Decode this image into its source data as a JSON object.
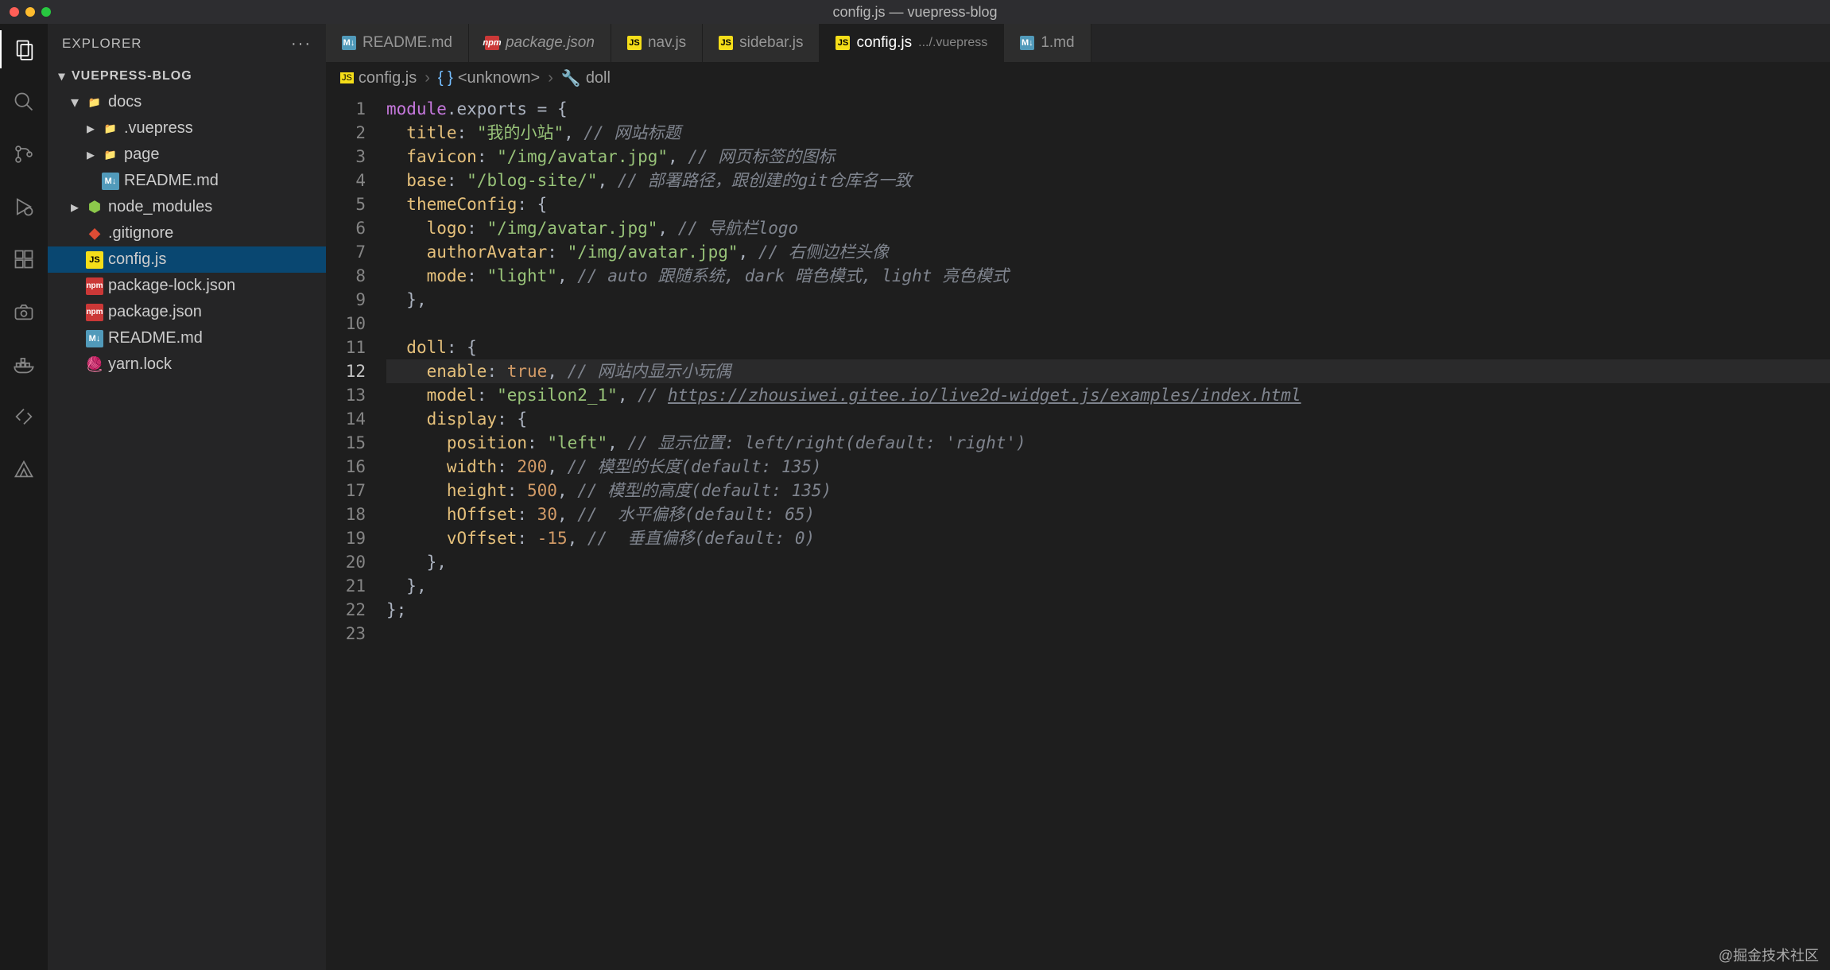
{
  "titlebar": {
    "text": "config.js — vuepress-blog"
  },
  "sidebar": {
    "title": "EXPLORER",
    "more": "···",
    "project": "VUEPRESS-BLOG"
  },
  "tree": [
    {
      "depth": 1,
      "chev": "▾",
      "icon": "folder-red",
      "label": "docs"
    },
    {
      "depth": 2,
      "chev": "▸",
      "icon": "folder",
      "label": ".vuepress"
    },
    {
      "depth": 2,
      "chev": "▸",
      "icon": "folder-red",
      "label": "page"
    },
    {
      "depth": 2,
      "chev": "",
      "icon": "md",
      "label": "README.md"
    },
    {
      "depth": 1,
      "chev": "▸",
      "icon": "node",
      "label": "node_modules"
    },
    {
      "depth": 1,
      "chev": "",
      "icon": "git",
      "label": ".gitignore"
    },
    {
      "depth": 1,
      "chev": "",
      "icon": "js",
      "label": "config.js",
      "selected": true
    },
    {
      "depth": 1,
      "chev": "",
      "icon": "npm",
      "label": "package-lock.json"
    },
    {
      "depth": 1,
      "chev": "",
      "icon": "npm",
      "label": "package.json"
    },
    {
      "depth": 1,
      "chev": "",
      "icon": "md",
      "label": "README.md"
    },
    {
      "depth": 1,
      "chev": "",
      "icon": "yarn",
      "label": "yarn.lock"
    }
  ],
  "tabs": [
    {
      "icon": "md",
      "label": "README.md",
      "active": false
    },
    {
      "icon": "npm",
      "label": "package.json",
      "italic": true,
      "active": false
    },
    {
      "icon": "js",
      "label": "nav.js",
      "active": false
    },
    {
      "icon": "js",
      "label": "sidebar.js",
      "active": false
    },
    {
      "icon": "js",
      "label": "config.js",
      "suffix": ".../.vuepress",
      "active": true
    },
    {
      "icon": "md",
      "label": "1.md",
      "active": false
    }
  ],
  "breadcrumbs": {
    "icon0": "js",
    "item0": "config.js",
    "item1": "<unknown>",
    "item2": "doll"
  },
  "code": {
    "lines": [
      [
        [
          "module",
          "kw"
        ],
        [
          ".exports = ",
          "punc"
        ],
        [
          "{",
          "punc"
        ]
      ],
      [
        [
          "  ",
          "p"
        ],
        [
          "title",
          "prop"
        ],
        [
          ": ",
          "punc"
        ],
        [
          "\"我的小站\"",
          "str"
        ],
        [
          ", ",
          "punc"
        ],
        [
          "// 网站标题",
          "com"
        ]
      ],
      [
        [
          "  ",
          "p"
        ],
        [
          "favicon",
          "prop"
        ],
        [
          ": ",
          "punc"
        ],
        [
          "\"/img/avatar.jpg\"",
          "str"
        ],
        [
          ", ",
          "punc"
        ],
        [
          "// 网页标签的图标",
          "com"
        ]
      ],
      [
        [
          "  ",
          "p"
        ],
        [
          "base",
          "prop"
        ],
        [
          ": ",
          "punc"
        ],
        [
          "\"/blog-site/\"",
          "str"
        ],
        [
          ", ",
          "punc"
        ],
        [
          "// 部署路径，跟创建的git仓库名一致",
          "com"
        ]
      ],
      [
        [
          "  ",
          "p"
        ],
        [
          "themeConfig",
          "prop"
        ],
        [
          ": ",
          "punc"
        ],
        [
          "{",
          "punc"
        ]
      ],
      [
        [
          "    ",
          "p"
        ],
        [
          "logo",
          "prop"
        ],
        [
          ": ",
          "punc"
        ],
        [
          "\"/img/avatar.jpg\"",
          "str"
        ],
        [
          ", ",
          "punc"
        ],
        [
          "// 导航栏logo",
          "com"
        ]
      ],
      [
        [
          "    ",
          "p"
        ],
        [
          "authorAvatar",
          "prop"
        ],
        [
          ": ",
          "punc"
        ],
        [
          "\"/img/avatar.jpg\"",
          "str"
        ],
        [
          ", ",
          "punc"
        ],
        [
          "// 右侧边栏头像",
          "com"
        ]
      ],
      [
        [
          "    ",
          "p"
        ],
        [
          "mode",
          "prop"
        ],
        [
          ": ",
          "punc"
        ],
        [
          "\"light\"",
          "str"
        ],
        [
          ", ",
          "punc"
        ],
        [
          "// auto 跟随系统, dark 暗色模式, light 亮色模式",
          "com"
        ]
      ],
      [
        [
          "  ",
          "p"
        ],
        [
          "},",
          "punc"
        ]
      ],
      [
        [
          "",
          "p"
        ]
      ],
      [
        [
          "  ",
          "p"
        ],
        [
          "doll",
          "prop"
        ],
        [
          ": ",
          "punc"
        ],
        [
          "{",
          "punc"
        ]
      ],
      [
        [
          "    ",
          "p"
        ],
        [
          "enable",
          "prop"
        ],
        [
          ": ",
          "punc"
        ],
        [
          "true",
          "bool"
        ],
        [
          ", ",
          "punc"
        ],
        [
          "// 网站内显示小玩偶",
          "com"
        ]
      ],
      [
        [
          "    ",
          "p"
        ],
        [
          "model",
          "prop"
        ],
        [
          ": ",
          "punc"
        ],
        [
          "\"epsilon2_1\"",
          "str"
        ],
        [
          ", ",
          "punc"
        ],
        [
          "// ",
          "com"
        ],
        [
          "https://zhousiwei.gitee.io/live2d-widget.js/examples/index.html",
          "link"
        ]
      ],
      [
        [
          "    ",
          "p"
        ],
        [
          "display",
          "prop"
        ],
        [
          ": ",
          "punc"
        ],
        [
          "{",
          "punc"
        ]
      ],
      [
        [
          "      ",
          "p"
        ],
        [
          "position",
          "prop"
        ],
        [
          ": ",
          "punc"
        ],
        [
          "\"left\"",
          "str"
        ],
        [
          ", ",
          "punc"
        ],
        [
          "// 显示位置: left/right(default: 'right')",
          "com"
        ]
      ],
      [
        [
          "      ",
          "p"
        ],
        [
          "width",
          "prop"
        ],
        [
          ": ",
          "punc"
        ],
        [
          "200",
          "num"
        ],
        [
          ", ",
          "punc"
        ],
        [
          "// 模型的长度(default: 135)",
          "com"
        ]
      ],
      [
        [
          "      ",
          "p"
        ],
        [
          "height",
          "prop"
        ],
        [
          ": ",
          "punc"
        ],
        [
          "500",
          "num"
        ],
        [
          ", ",
          "punc"
        ],
        [
          "// 模型的高度(default: 135)",
          "com"
        ]
      ],
      [
        [
          "      ",
          "p"
        ],
        [
          "hOffset",
          "prop"
        ],
        [
          ": ",
          "punc"
        ],
        [
          "30",
          "num"
        ],
        [
          ", ",
          "punc"
        ],
        [
          "//  水平偏移(default: 65)",
          "com"
        ]
      ],
      [
        [
          "      ",
          "p"
        ],
        [
          "vOffset",
          "prop"
        ],
        [
          ": ",
          "punc"
        ],
        [
          "-15",
          "num"
        ],
        [
          ", ",
          "punc"
        ],
        [
          "//  垂直偏移(default: 0)",
          "com"
        ]
      ],
      [
        [
          "    ",
          "p"
        ],
        [
          "},",
          "punc"
        ]
      ],
      [
        [
          "  ",
          "p"
        ],
        [
          "},",
          "punc"
        ]
      ],
      [
        [
          "};",
          "punc"
        ]
      ],
      [
        [
          "",
          "p"
        ]
      ]
    ],
    "currentLine": 12
  },
  "watermark": "@掘金技术社区"
}
